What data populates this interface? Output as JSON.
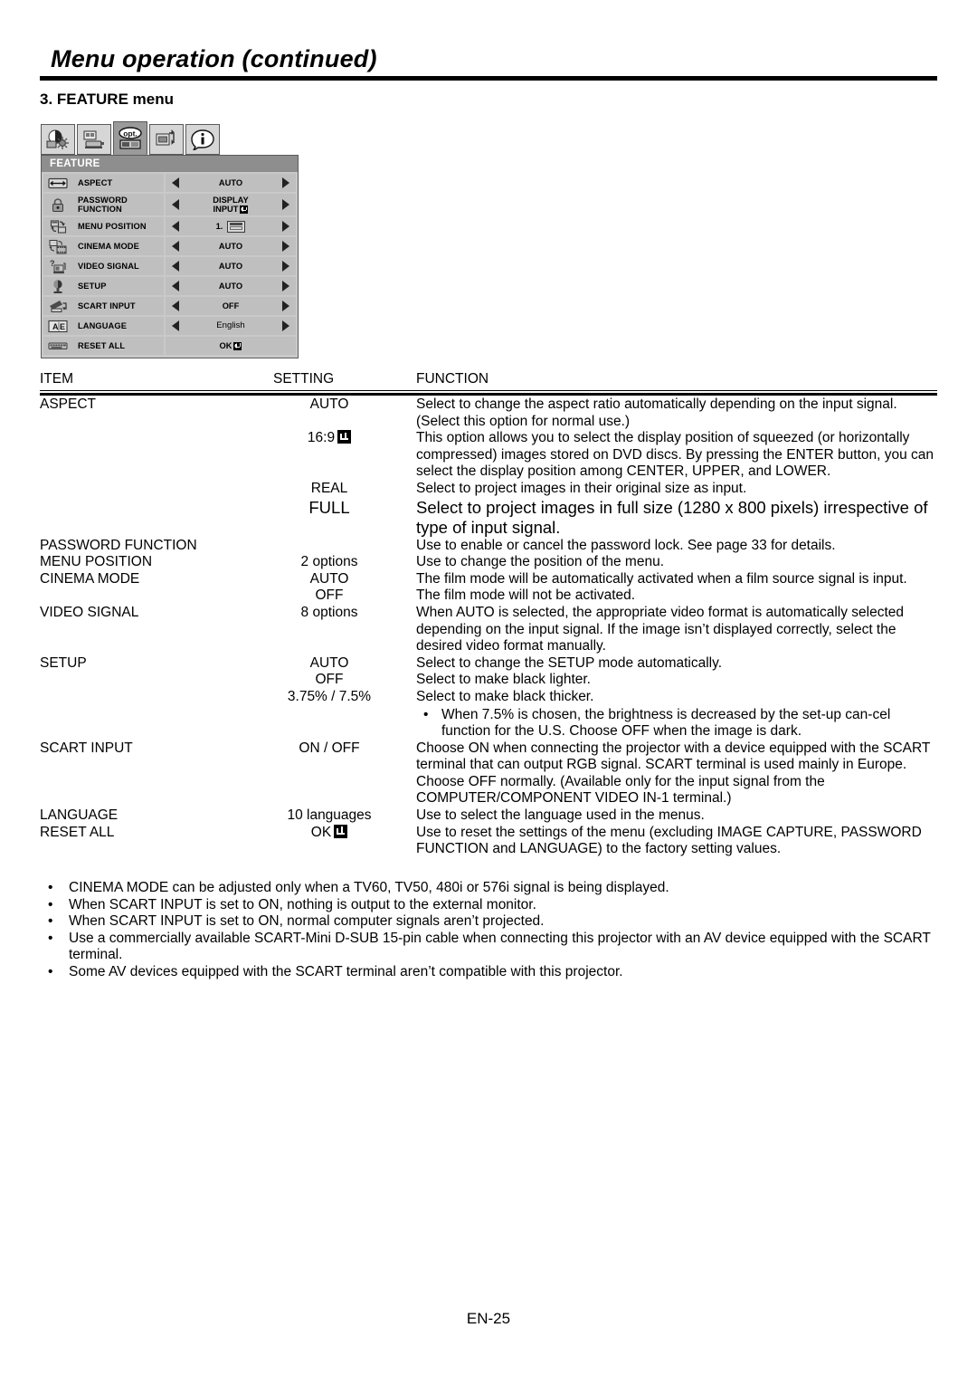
{
  "header": {
    "title": "Menu operation (continued)",
    "section": "3. FEATURE menu"
  },
  "osd": {
    "tabs": [
      {
        "name": "image-tab",
        "label": "IMAGE",
        "selected": false
      },
      {
        "name": "installation-tab",
        "label": "INSTALLATION",
        "selected": false
      },
      {
        "name": "feature-tab",
        "label": "opt.",
        "selected": true
      },
      {
        "name": "signal-tab",
        "label": "SIGNAL",
        "selected": false
      },
      {
        "name": "information-tab",
        "label": "INFORMATION",
        "selected": false
      }
    ],
    "header_label": "FEATURE",
    "rows": [
      {
        "icon": "aspect-icon",
        "label": "ASPECT",
        "label2": "",
        "value": "AUTO",
        "value2": "",
        "arrows": true,
        "enter": false,
        "posbox": false,
        "thin": false
      },
      {
        "icon": "password-icon",
        "label": "PASSWORD",
        "label2": "FUNCTION",
        "value": "DISPLAY",
        "value2": "INPUT",
        "arrows": true,
        "enter": true,
        "posbox": false,
        "thin": false
      },
      {
        "icon": "menu-position-icon",
        "label": "MENU POSITION",
        "label2": "",
        "value": "1.",
        "value2": "",
        "arrows": true,
        "enter": false,
        "posbox": true,
        "thin": false
      },
      {
        "icon": "cinema-mode-icon",
        "label": "CINEMA MODE",
        "label2": "",
        "value": "AUTO",
        "value2": "",
        "arrows": true,
        "enter": false,
        "posbox": false,
        "thin": false
      },
      {
        "icon": "video-signal-icon",
        "label": "VIDEO SIGNAL",
        "label2": "",
        "value": "AUTO",
        "value2": "",
        "arrows": true,
        "enter": false,
        "posbox": false,
        "thin": false
      },
      {
        "icon": "setup-icon",
        "label": "SETUP",
        "label2": "",
        "value": "AUTO",
        "value2": "",
        "arrows": true,
        "enter": false,
        "posbox": false,
        "thin": false
      },
      {
        "icon": "scart-input-icon",
        "label": "SCART INPUT",
        "label2": "",
        "value": "OFF",
        "value2": "",
        "arrows": true,
        "enter": false,
        "posbox": false,
        "thin": false
      },
      {
        "icon": "language-icon",
        "label": "LANGUAGE",
        "label2": "",
        "value": "English",
        "value2": "",
        "arrows": true,
        "enter": false,
        "posbox": false,
        "thin": true
      },
      {
        "icon": "reset-all-icon",
        "label": "RESET ALL",
        "label2": "",
        "value": "OK",
        "value2": "",
        "arrows": false,
        "enter": true,
        "posbox": false,
        "thin": false
      }
    ]
  },
  "table": {
    "headers": {
      "item": "ITEM",
      "setting": "SETTING",
      "function": "FUNCTION"
    },
    "rows": [
      {
        "item": "ASPECT",
        "setting": "AUTO",
        "setting_enter": false,
        "function": "Select to change the aspect ratio automatically depending on the input signal. (Select this option for normal use.)",
        "big": false,
        "sub": ""
      },
      {
        "item": "",
        "setting": "16:9",
        "setting_enter": true,
        "function": "This option allows you to select the display position of squeezed (or horizontally compressed) images stored on DVD discs. By pressing the ENTER button, you can select the display position among CENTER, UPPER, and LOWER.",
        "big": false,
        "sub": ""
      },
      {
        "item": "",
        "setting": "REAL",
        "setting_enter": false,
        "function": "Select to project images in their original size as input.",
        "big": false,
        "sub": ""
      },
      {
        "item": "",
        "setting": "FULL",
        "setting_enter": false,
        "function": "Select to project images in full size (1280 x 800 pixels) irrespective of type of input signal.",
        "big": true,
        "sub": ""
      },
      {
        "item": "PASSWORD FUNCTION",
        "setting": "",
        "setting_enter": false,
        "function": "Use to enable or cancel the password lock. See page 33 for details.",
        "big": false,
        "sub": ""
      },
      {
        "item": "MENU POSITION",
        "setting": "2 options",
        "setting_enter": false,
        "function": "Use to change the position of the menu.",
        "big": false,
        "sub": ""
      },
      {
        "item": "CINEMA MODE",
        "setting": "AUTO",
        "setting_enter": false,
        "function": "The film mode will be automatically activated when a film source signal is input.",
        "big": false,
        "sub": ""
      },
      {
        "item": "",
        "setting": "OFF",
        "setting_enter": false,
        "function": "The film mode will not be activated.",
        "big": false,
        "sub": ""
      },
      {
        "item": "VIDEO SIGNAL",
        "setting": "8 options",
        "setting_enter": false,
        "function": "When AUTO is selected, the appropriate video format is automatically selected depending on the input signal. If the image isn’t displayed correctly, select the desired video format manually.",
        "big": false,
        "sub": ""
      },
      {
        "item": "SETUP",
        "setting": "AUTO",
        "setting_enter": false,
        "function": "Select to change the SETUP mode automatically.",
        "big": false,
        "sub": ""
      },
      {
        "item": "",
        "setting": "OFF",
        "setting_enter": false,
        "function": "Select to make black lighter.",
        "big": false,
        "sub": ""
      },
      {
        "item": "",
        "setting": "3.75% / 7.5%",
        "setting_enter": false,
        "function": "Select to make black thicker.",
        "big": false,
        "sub": "When 7.5% is chosen, the brightness is decreased by the set-up can-cel function for the U.S. Choose OFF when the image is dark."
      },
      {
        "item": "SCART INPUT",
        "setting": "ON / OFF",
        "setting_enter": false,
        "function": "Choose ON when connecting the projector with a device equipped with the SCART terminal that can output RGB signal. SCART terminal is used mainly in Europe. Choose OFF normally. (Available only for the input signal from the COMPUTER/COMPONENT VIDEO IN-1 terminal.)",
        "big": false,
        "sub": ""
      },
      {
        "item": "LANGUAGE",
        "setting": "10 languages",
        "setting_enter": false,
        "function": "Use to select the language used in the menus.",
        "big": false,
        "sub": ""
      },
      {
        "item": "RESET ALL",
        "setting": "OK",
        "setting_enter": true,
        "function": "Use to reset the settings of the menu (excluding IMAGE CAPTURE, PASSWORD FUNCTION and LANGUAGE) to the factory setting values.",
        "big": false,
        "sub": ""
      }
    ]
  },
  "notes": [
    "CINEMA MODE can be adjusted only when a TV60, TV50, 480i or 576i signal is being displayed.",
    "When SCART INPUT is set to ON, nothing is output to the external monitor.",
    "When SCART INPUT is set to ON, normal computer signals aren’t projected.",
    "Use a commercially available SCART-Mini D-SUB 15-pin cable when connecting this projector with an AV device equipped with the SCART terminal.",
    "Some AV devices equipped with the SCART terminal aren’t compatible with this projector."
  ],
  "bullet_glyph": "•",
  "footer": {
    "page_number": "EN-25"
  }
}
